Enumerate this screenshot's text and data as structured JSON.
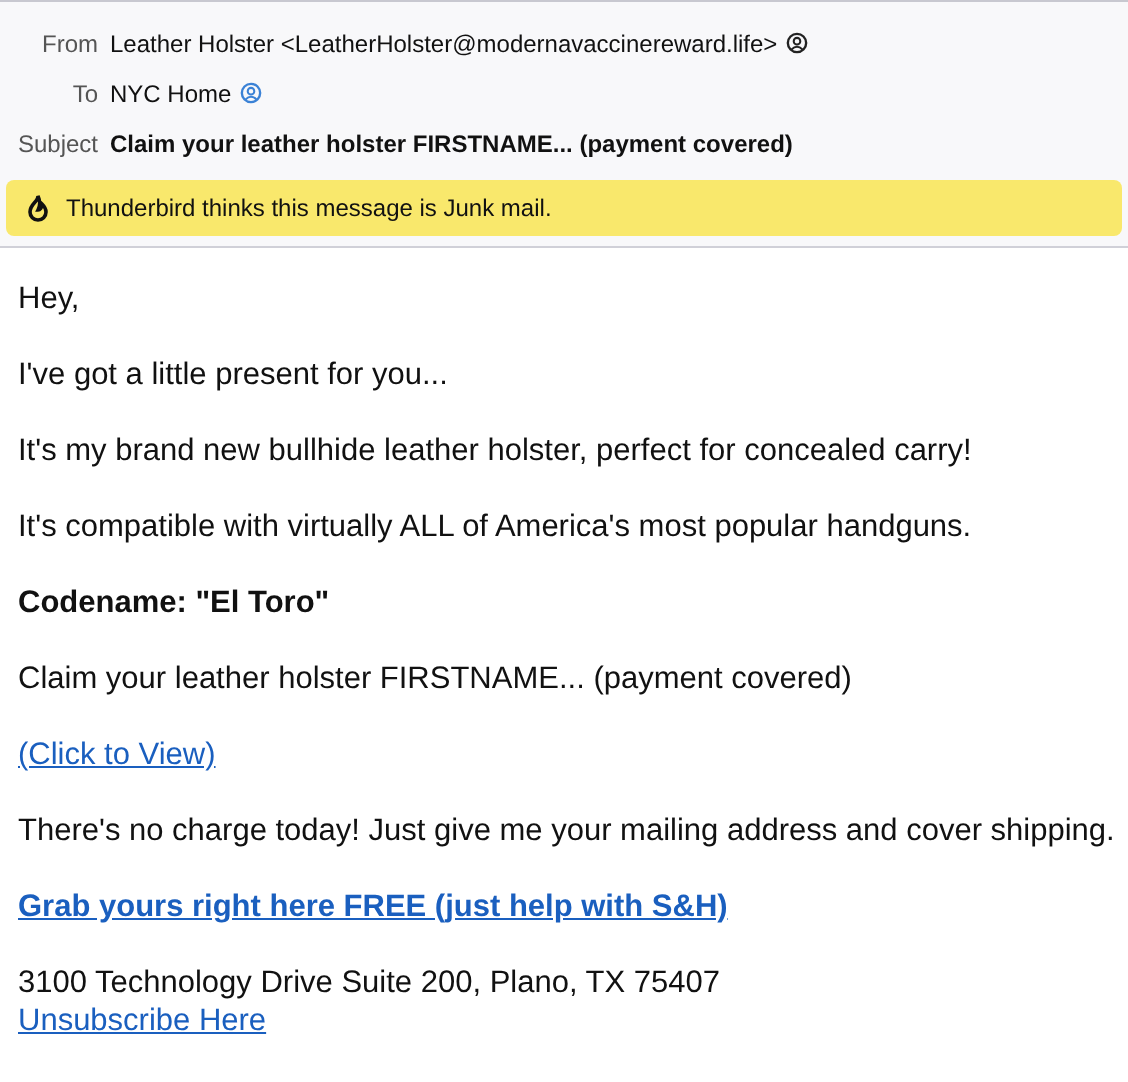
{
  "header": {
    "fields": [
      {
        "label": "From",
        "value": "Leather Holster <LeatherHolster@modernavaccinereward.life>",
        "kind": "from"
      },
      {
        "label": "To",
        "value": "NYC Home",
        "kind": "to"
      },
      {
        "label": "Subject",
        "value": "Claim your leather holster FIRSTNAME... (payment covered)",
        "kind": "subject"
      }
    ],
    "junk_notice": "Thunderbird thinks this message is Junk mail."
  },
  "body": [
    {
      "kind": "text",
      "text": "Hey,"
    },
    {
      "kind": "text",
      "text": "I've got a little present for you..."
    },
    {
      "kind": "text",
      "text": "It's my brand new bullhide leather holster, perfect for concealed carry!"
    },
    {
      "kind": "text",
      "text": "It's compatible with virtually ALL of America's most popular handguns."
    },
    {
      "kind": "bold",
      "text": "Codename: \"El Toro\""
    },
    {
      "kind": "text",
      "text": "Claim your leather holster FIRSTNAME... (payment covered)"
    },
    {
      "kind": "link",
      "text": "(Click to View)"
    },
    {
      "kind": "text",
      "text": "There's no charge today! Just give me your mailing address and cover shipping."
    },
    {
      "kind": "boldlink",
      "text": "Grab yours right here FREE (just help with S&H)"
    }
  ],
  "footer": {
    "address": "3100 Technology Drive Suite 200, Plano, TX 75407",
    "unsubscribe": "Unsubscribe Here"
  }
}
